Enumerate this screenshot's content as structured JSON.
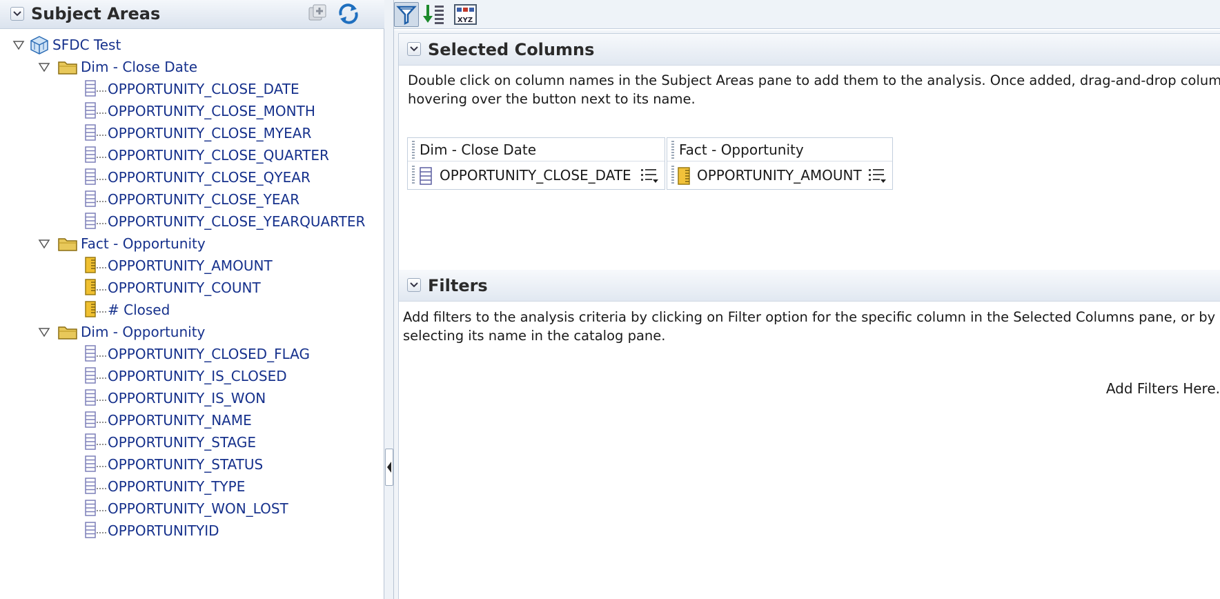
{
  "subject_areas": {
    "title": "Subject Areas",
    "root": {
      "label": "SFDC Test",
      "folders": [
        {
          "label": "Dim - Close Date",
          "type": "dimension",
          "columns": [
            "OPPORTUNITY_CLOSE_DATE",
            "OPPORTUNITY_CLOSE_MONTH",
            "OPPORTUNITY_CLOSE_MYEAR",
            "OPPORTUNITY_CLOSE_QUARTER",
            "OPPORTUNITY_CLOSE_QYEAR",
            "OPPORTUNITY_CLOSE_YEAR",
            "OPPORTUNITY_CLOSE_YEARQUARTER"
          ]
        },
        {
          "label": "Fact - Opportunity",
          "type": "measure",
          "columns": [
            "OPPORTUNITY_AMOUNT",
            "OPPORTUNITY_COUNT",
            "# Closed"
          ]
        },
        {
          "label": "Dim - Opportunity",
          "type": "dimension",
          "columns": [
            "OPPORTUNITY_CLOSED_FLAG",
            "OPPORTUNITY_IS_CLOSED",
            "OPPORTUNITY_IS_WON",
            "OPPORTUNITY_NAME",
            "OPPORTUNITY_STAGE",
            "OPPORTUNITY_STATUS",
            "OPPORTUNITY_TYPE",
            "OPPORTUNITY_WON_LOST",
            "OPPORTUNITYID"
          ]
        }
      ]
    }
  },
  "toolbar": {
    "icons": [
      "filter-icon",
      "sort-icon",
      "xyz-icon"
    ]
  },
  "selected_columns": {
    "title": "Selected Columns",
    "description_line1": "Double click on column names in the Subject Areas pane to add them to the analysis. Once added, drag-and-drop columns to",
    "description_line2": "hovering over the button next to its name.",
    "groups": [
      {
        "folder": "Dim - Close Date",
        "column": "OPPORTUNITY_CLOSE_DATE",
        "type": "dimension"
      },
      {
        "folder": "Fact - Opportunity",
        "column": "OPPORTUNITY_AMOUNT",
        "type": "measure"
      }
    ]
  },
  "filters": {
    "title": "Filters",
    "description_line1": "Add filters to the analysis criteria by clicking on Filter option for the specific column in the Selected Columns pane, or by clicking",
    "description_line2": "selecting its name in the catalog pane.",
    "drop_hint": "Add Filters Here."
  },
  "colors": {
    "tree_text": "#16318c",
    "header_bg": "#dbe3ee",
    "folder": "#e8c85a",
    "measure": "#f0c030",
    "dimension": "#7c7fb8"
  }
}
